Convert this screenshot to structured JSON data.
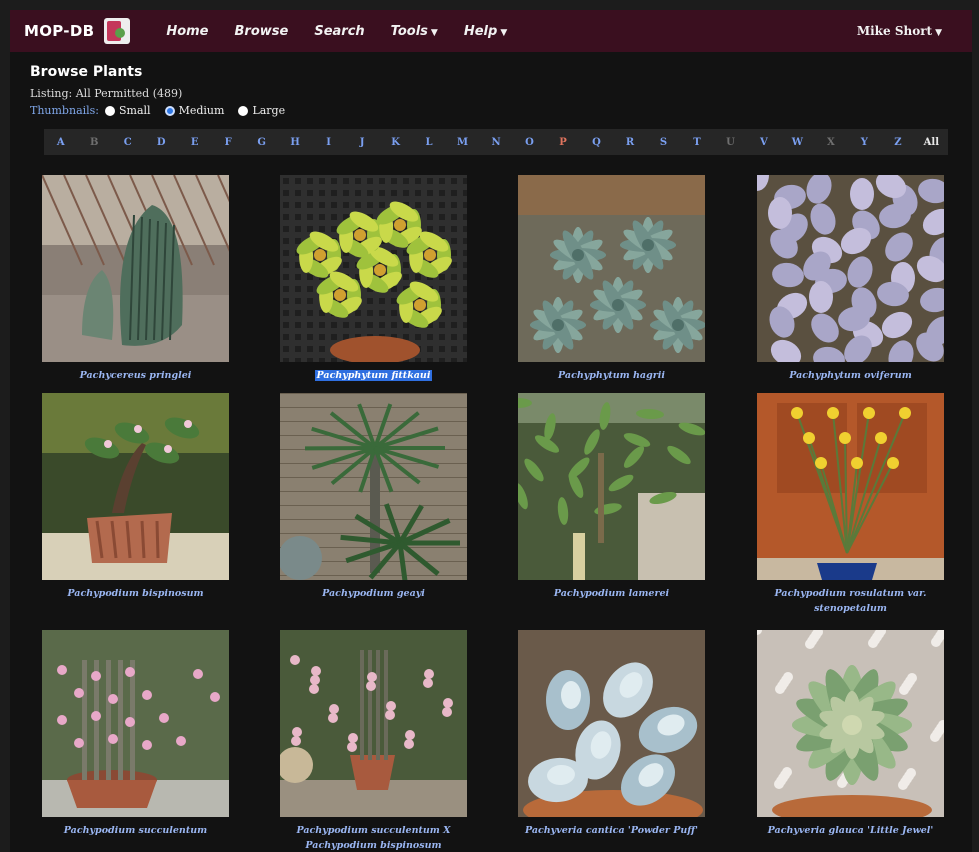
{
  "navbar": {
    "brand": "MOP-DB",
    "items": [
      {
        "label": "Home",
        "dropdown": false
      },
      {
        "label": "Browse",
        "dropdown": false
      },
      {
        "label": "Search",
        "dropdown": false
      },
      {
        "label": "Tools",
        "dropdown": true
      },
      {
        "label": "Help",
        "dropdown": true
      }
    ],
    "user": "Mike Short"
  },
  "page": {
    "title": "Browse Plants",
    "listing": "Listing: All Permitted (489)",
    "thumbnails_label": "Thumbnails:",
    "thumbnail_options": [
      {
        "label": "Small",
        "selected": false
      },
      {
        "label": "Medium",
        "selected": true
      },
      {
        "label": "Large",
        "selected": false
      }
    ]
  },
  "alphabet": [
    {
      "l": "A",
      "s": "on"
    },
    {
      "l": "B",
      "s": "off"
    },
    {
      "l": "C",
      "s": "on"
    },
    {
      "l": "D",
      "s": "on"
    },
    {
      "l": "E",
      "s": "on"
    },
    {
      "l": "F",
      "s": "on"
    },
    {
      "l": "G",
      "s": "on"
    },
    {
      "l": "H",
      "s": "on"
    },
    {
      "l": "I",
      "s": "on"
    },
    {
      "l": "J",
      "s": "on"
    },
    {
      "l": "K",
      "s": "on"
    },
    {
      "l": "L",
      "s": "on"
    },
    {
      "l": "M",
      "s": "on"
    },
    {
      "l": "N",
      "s": "on"
    },
    {
      "l": "O",
      "s": "on"
    },
    {
      "l": "P",
      "s": "hot"
    },
    {
      "l": "Q",
      "s": "on"
    },
    {
      "l": "R",
      "s": "on"
    },
    {
      "l": "S",
      "s": "on"
    },
    {
      "l": "T",
      "s": "on"
    },
    {
      "l": "U",
      "s": "off"
    },
    {
      "l": "V",
      "s": "on"
    },
    {
      "l": "W",
      "s": "on"
    },
    {
      "l": "X",
      "s": "off"
    },
    {
      "l": "Y",
      "s": "on"
    },
    {
      "l": "Z",
      "s": "on"
    },
    {
      "l": "All",
      "s": "all"
    }
  ],
  "plants": [
    {
      "name": "Pachycereus pringlei",
      "kind": "cactus",
      "selected": false
    },
    {
      "name": "Pachyphytum fittkaui",
      "kind": "jade",
      "selected": true
    },
    {
      "name": "Pachyphytum hagrii",
      "kind": "rosette-green",
      "selected": false
    },
    {
      "name": "Pachyphytum oviferum",
      "kind": "pebbles",
      "selected": false
    },
    {
      "name": "Pachypodium bispinosum",
      "kind": "caudex-pot",
      "selected": false
    },
    {
      "name": "Pachypodium geayi",
      "kind": "palm",
      "selected": false
    },
    {
      "name": "Pachypodium lamerei",
      "kind": "garden",
      "selected": false
    },
    {
      "name": "Pachypodium rosulatum var. stenopetalum",
      "kind": "yellow-flowers",
      "selected": false
    },
    {
      "name": "Pachypodium succulentum",
      "kind": "pink-bowl",
      "selected": false
    },
    {
      "name": "Pachypodium succulentum X Pachypodium bispinosum",
      "kind": "pink-shrub",
      "selected": false
    },
    {
      "name": "Pachyveria cantica 'Powder Puff'",
      "kind": "blue-succulent",
      "selected": false
    },
    {
      "name": "Pachyveria glauca 'Little Jewel'",
      "kind": "jewel",
      "selected": false
    }
  ]
}
